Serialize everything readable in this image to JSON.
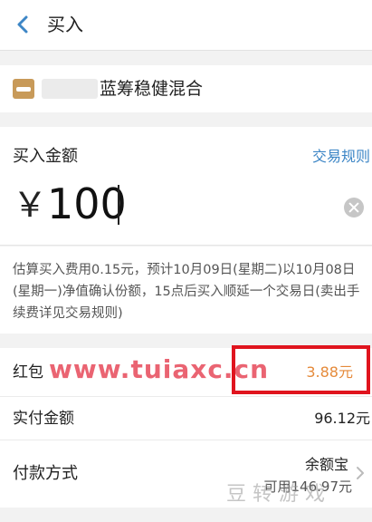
{
  "header": {
    "title": "买入",
    "back_icon": "chevron-left-icon"
  },
  "fund": {
    "name": "蓝筹稳健混合",
    "logo_icon": "fund-logo-icon"
  },
  "amount": {
    "label": "买入金额",
    "rules_link": "交易规则",
    "currency": "￥",
    "value": "100",
    "clear_icon": "clear-icon"
  },
  "estimate": {
    "text": "估算买入费用0.15元，预计10月09日(星期二)以10月08日(星期一)净值确认份额，15点后买入顺延一个交易日(卖出手续费详见交易规则)"
  },
  "rows": {
    "red_packet_label": "红包",
    "red_packet_value": "3.88元",
    "paid_label": "实付金额",
    "paid_value": "96.12元",
    "pay_label": "付款方式",
    "pay_method": "余额宝",
    "pay_balance": "可用146.97元"
  },
  "overlay": {
    "watermark": "www.tuiaxc.cn",
    "logo_text": "豆 转 游 戏",
    "highlight_color": "#e0141e"
  },
  "colors": {
    "accent": "#3d86c6",
    "red_packet": "#e58a3a"
  }
}
